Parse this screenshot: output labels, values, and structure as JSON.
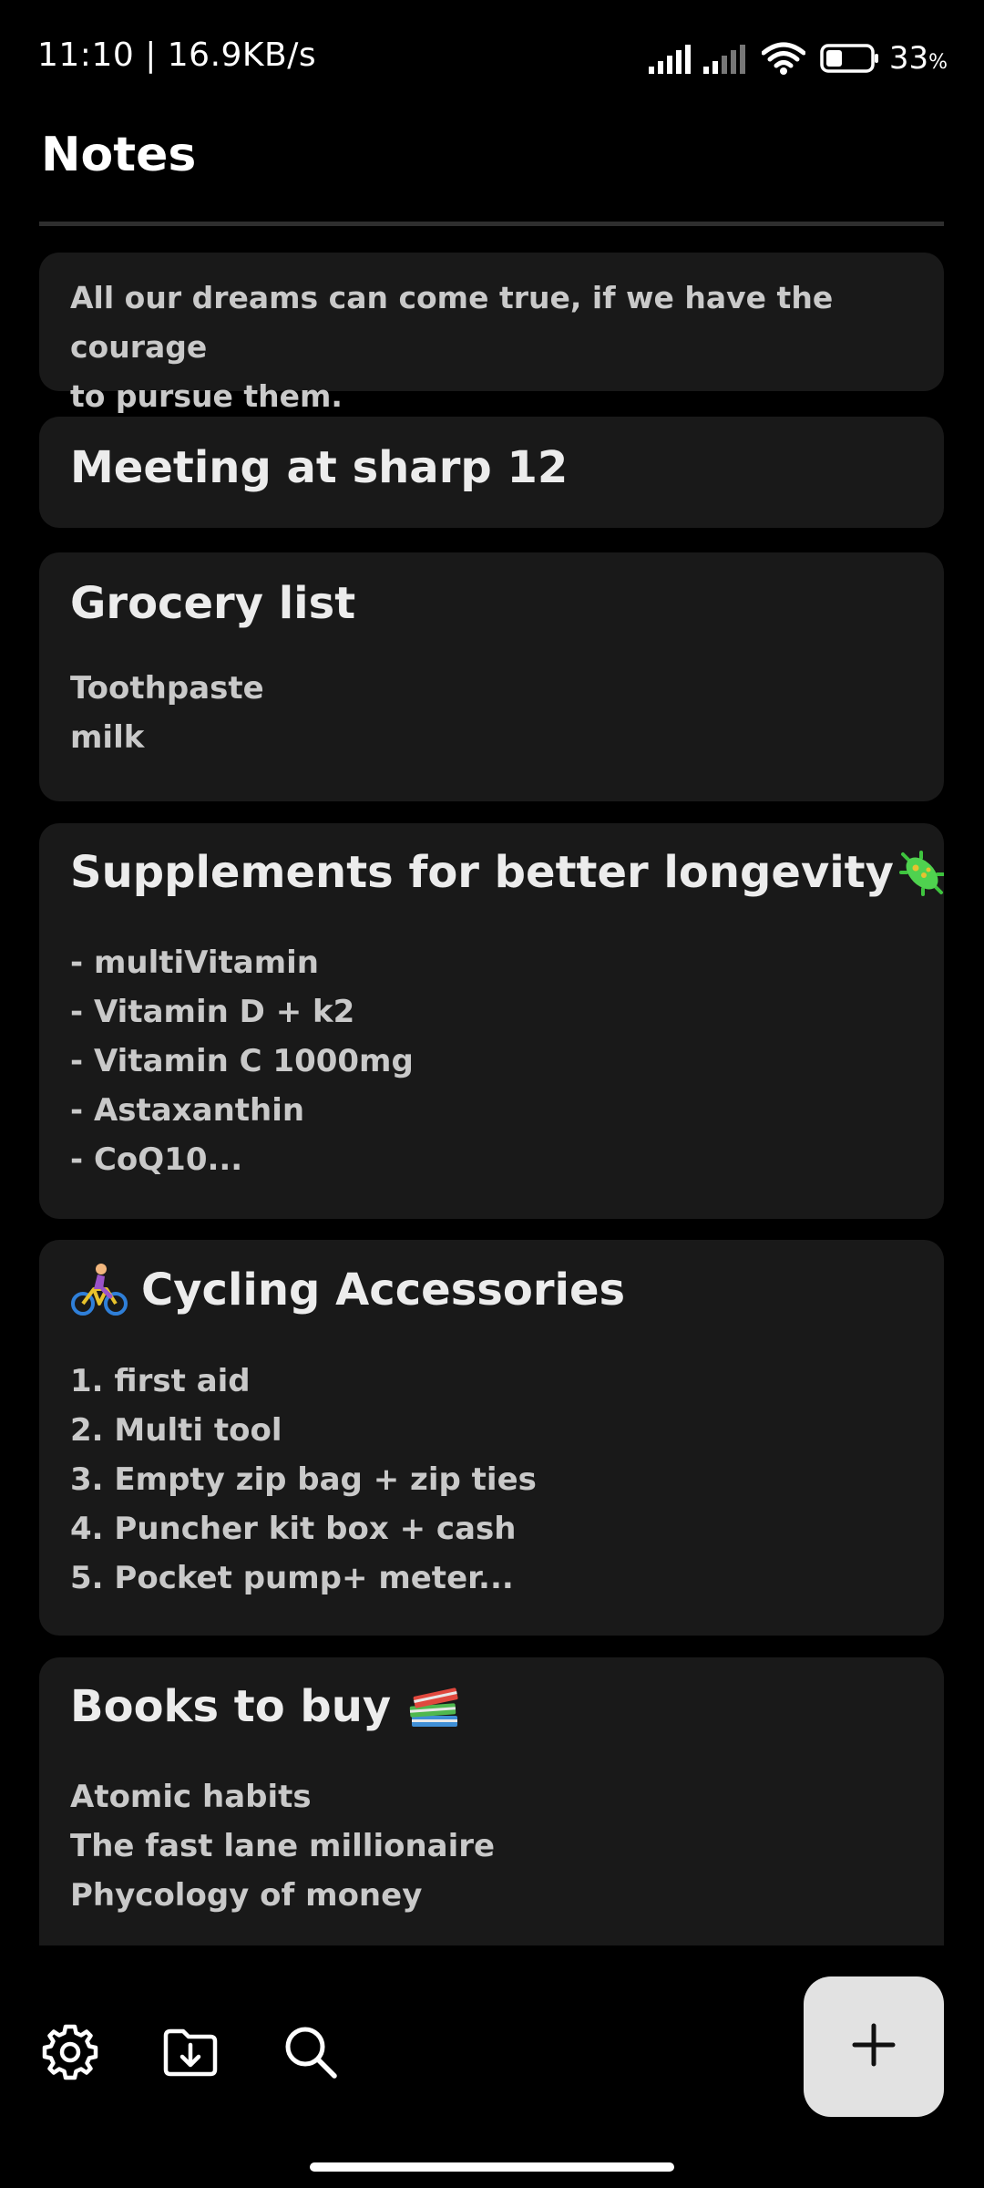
{
  "status_bar": {
    "time_speed": "11:10 | 16.9KB/s",
    "battery_value": "33",
    "battery_unit": "%",
    "icons": [
      "signal-icon",
      "signal-icon-2",
      "wifi-icon",
      "battery-icon"
    ]
  },
  "header": {
    "title": "Notes"
  },
  "notes": [
    {
      "title": "",
      "body": "All our dreams can come true, if we have the courage\nto pursue them."
    },
    {
      "title": "Meeting at  sharp 12",
      "body": ""
    },
    {
      "title": "Grocery list",
      "body": "Toothpaste\nmilk"
    },
    {
      "title": "Supplements for better longevity",
      "title_emoji": "microbe-emoji",
      "body": "- multiVitamin\n- Vitamin D + k2\n- Vitamin C 1000mg\n- Astaxanthin\n- CoQ10..."
    },
    {
      "title": "Cycling Accessories",
      "title_emoji": "cyclist-emoji",
      "body": "1. first aid\n2. Multi tool\n3. Empty zip bag + zip ties\n4. Puncher kit box + cash\n5. Pocket pump+ meter..."
    },
    {
      "title": "Books to buy",
      "title_emoji": "books-emoji",
      "body": "Atomic habits\nThe fast lane millionaire\nPhycology of money"
    }
  ],
  "bottom_bar": {
    "icons": [
      "settings-icon",
      "import-folder-icon",
      "search-icon",
      "add-icon"
    ]
  },
  "colors": {
    "background": "#000000",
    "card": "#191919",
    "fab": "#e2e2e2",
    "text_primary": "#ececec",
    "text_secondary": "#c9c9c9"
  }
}
